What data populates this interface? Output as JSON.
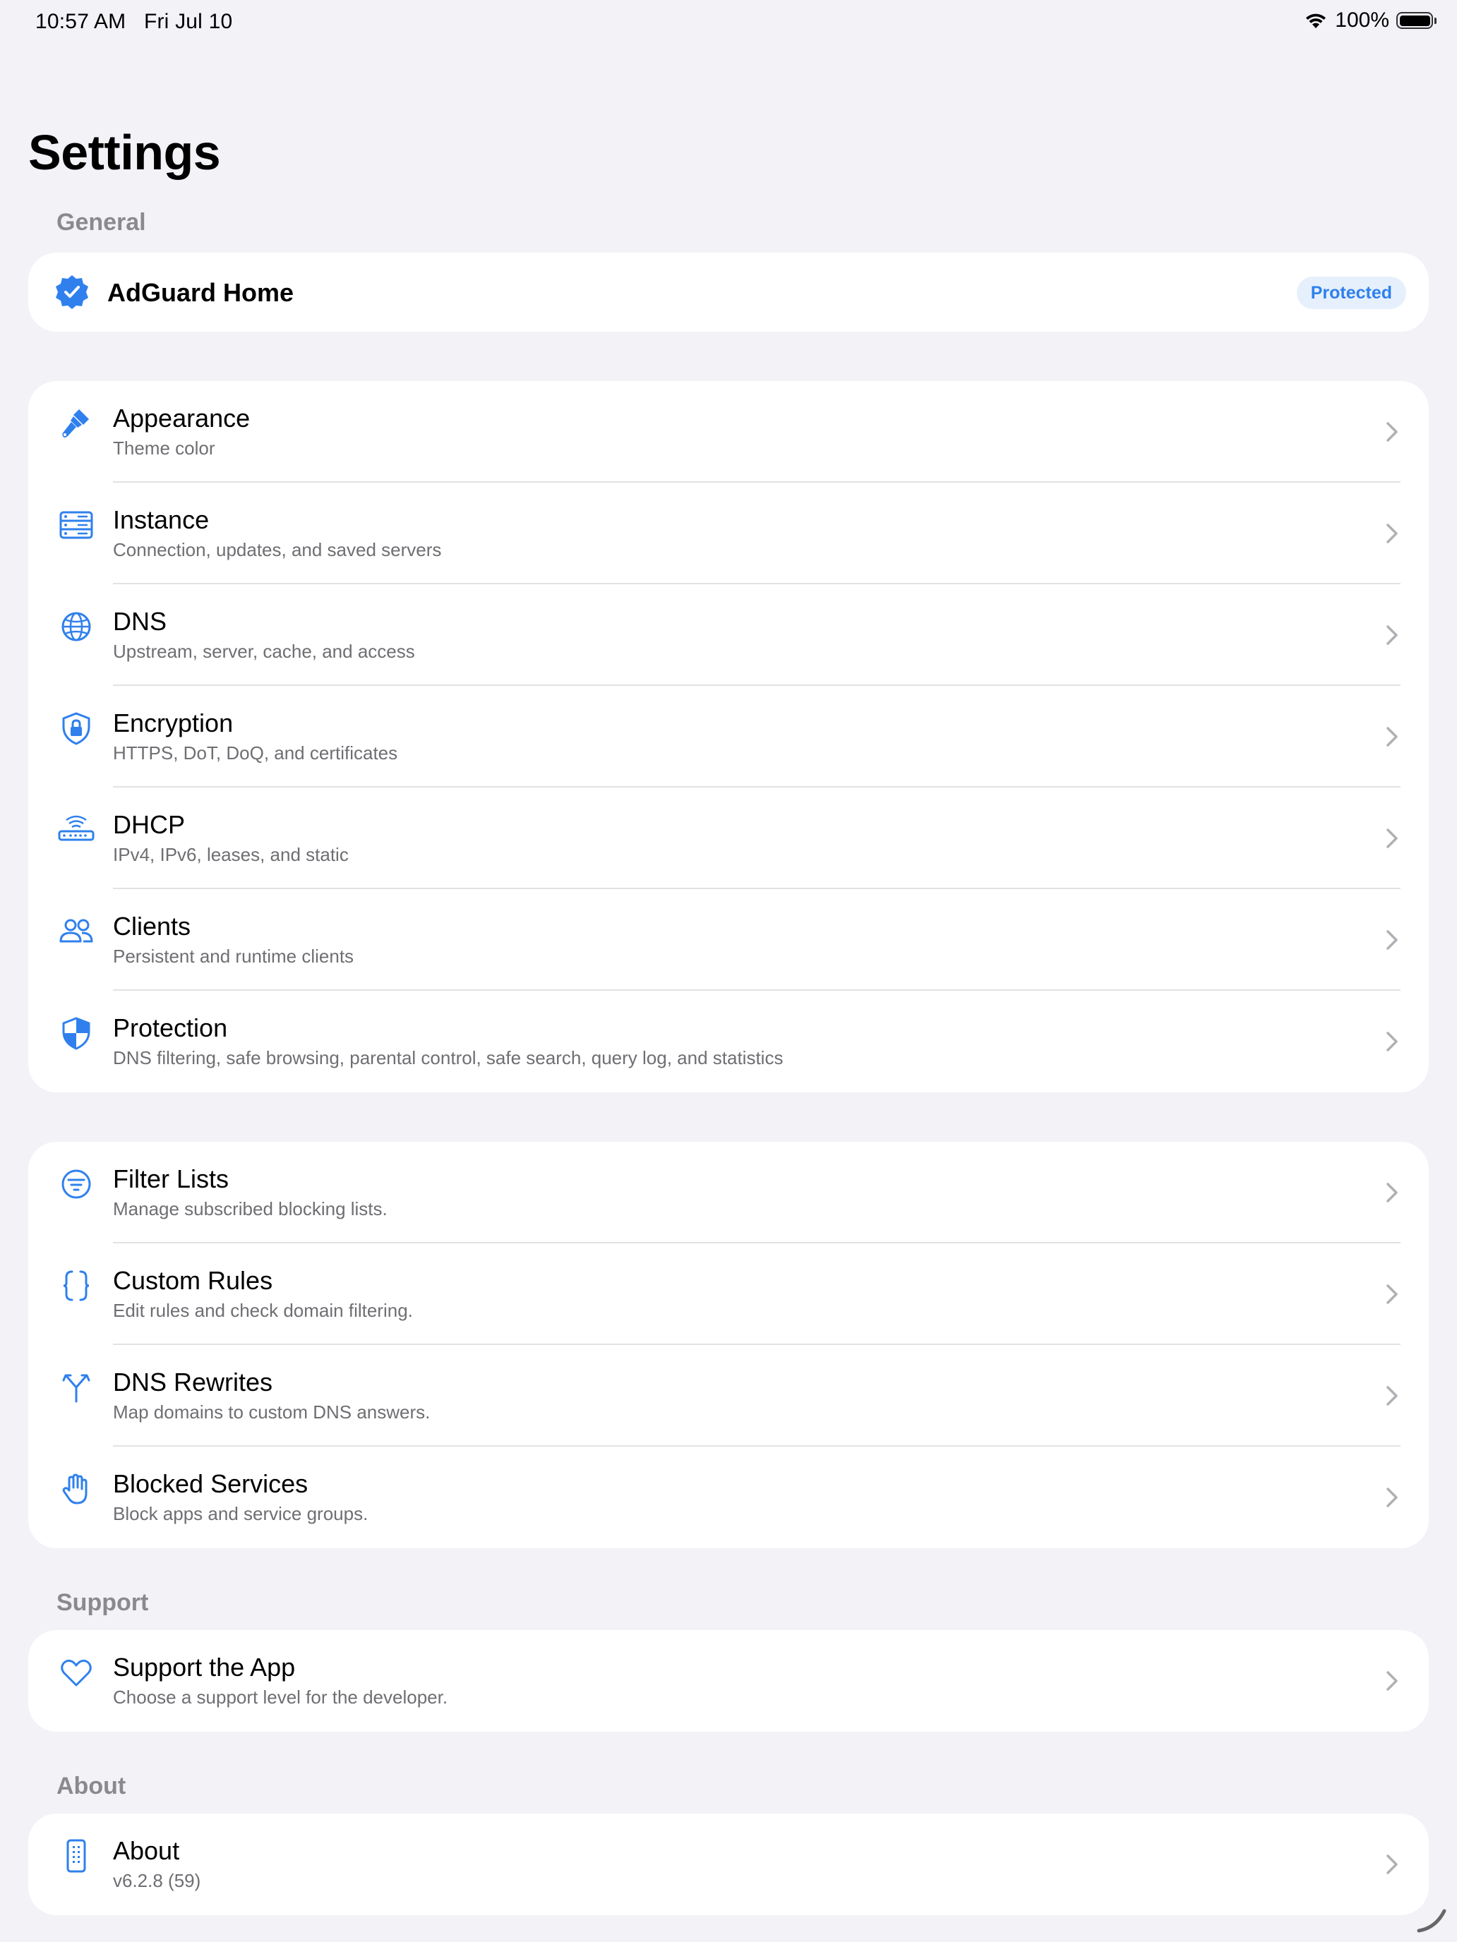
{
  "status_bar": {
    "time": "10:57 AM",
    "date": "Fri Jul 10",
    "battery": "100%"
  },
  "page_title": "Settings",
  "sections": {
    "general": "General",
    "support": "Support",
    "about": "About"
  },
  "server": {
    "name": "AdGuard Home",
    "status": "Protected"
  },
  "settings_group": [
    {
      "title": "Appearance",
      "subtitle": "Theme color",
      "icon": "paintbrush-icon"
    },
    {
      "title": "Instance",
      "subtitle": "Connection, updates, and saved servers",
      "icon": "server-icon"
    },
    {
      "title": "DNS",
      "subtitle": "Upstream, server, cache, and access",
      "icon": "globe-icon"
    },
    {
      "title": "Encryption",
      "subtitle": "HTTPS, DoT, DoQ, and certificates",
      "icon": "lock-shield-icon"
    },
    {
      "title": "DHCP",
      "subtitle": "IPv4, IPv6, leases, and static",
      "icon": "router-icon"
    },
    {
      "title": "Clients",
      "subtitle": "Persistent and runtime clients",
      "icon": "people-icon"
    },
    {
      "title": "Protection",
      "subtitle": "DNS filtering, safe browsing, parental control, safe search, query log, and statistics",
      "icon": "shield-icon"
    }
  ],
  "filtering_group": [
    {
      "title": "Filter Lists",
      "subtitle": "Manage subscribed blocking lists.",
      "icon": "filter-icon"
    },
    {
      "title": "Custom Rules",
      "subtitle": "Edit rules and check domain filtering.",
      "icon": "curly-braces-icon"
    },
    {
      "title": "DNS Rewrites",
      "subtitle": "Map domains to custom DNS answers.",
      "icon": "split-arrow-icon"
    },
    {
      "title": "Blocked Services",
      "subtitle": "Block apps and service groups.",
      "icon": "hand-icon"
    }
  ],
  "support_row": {
    "title": "Support the App",
    "subtitle": "Choose a support level for the developer.",
    "icon": "heart-icon"
  },
  "about_row": {
    "title": "About",
    "subtitle": "v6.2.8 (59)",
    "icon": "device-icon"
  },
  "colors": {
    "accent": "#2f80ed",
    "background": "#f2f2f7"
  }
}
